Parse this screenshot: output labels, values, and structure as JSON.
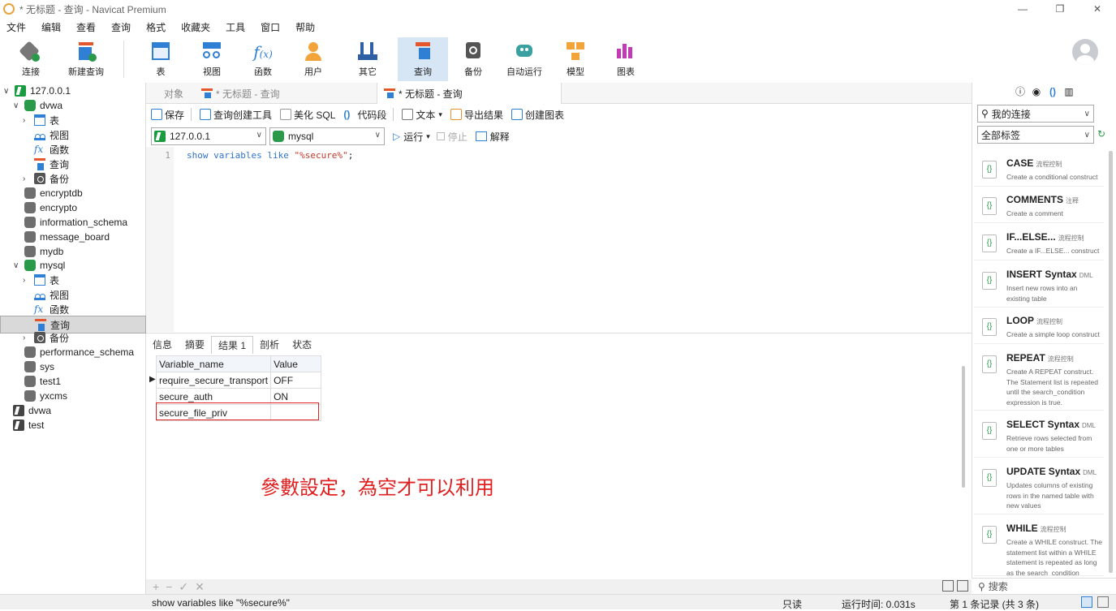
{
  "window": {
    "title": "* 无标题 - 查询 - Navicat Premium",
    "controls": [
      "—",
      "❐",
      "✕"
    ]
  },
  "menu": [
    "文件",
    "编辑",
    "查看",
    "查询",
    "格式",
    "收藏夹",
    "工具",
    "窗口",
    "帮助"
  ],
  "toolbar": [
    {
      "label": "连接",
      "icon": "connection-icon"
    },
    {
      "label": "新建查询",
      "icon": "new-query-icon"
    },
    {
      "label": "表",
      "icon": "table-icon"
    },
    {
      "label": "视图",
      "icon": "view-icon"
    },
    {
      "label": "函数",
      "icon": "function-icon"
    },
    {
      "label": "用户",
      "icon": "user-icon"
    },
    {
      "label": "其它",
      "icon": "tools-icon"
    },
    {
      "label": "查询",
      "icon": "query-icon"
    },
    {
      "label": "备份",
      "icon": "backup-icon"
    },
    {
      "label": "自动运行",
      "icon": "robot-icon"
    },
    {
      "label": "模型",
      "icon": "model-icon"
    },
    {
      "label": "图表",
      "icon": "chart-icon"
    }
  ],
  "tree": {
    "root": "127.0.0.1",
    "dvwa": "dvwa",
    "items_dvwa": [
      "表",
      "视图",
      "函数",
      "查询",
      "备份"
    ],
    "dbs": [
      "encryptdb",
      "encrypto",
      "information_schema",
      "message_board",
      "mydb"
    ],
    "mysql": "mysql",
    "items_mysql": [
      "表",
      "视图",
      "函数",
      "查询",
      "备份"
    ],
    "dbs2": [
      "performance_schema",
      "sys",
      "test1",
      "yxcms"
    ],
    "conns": [
      "dvwa",
      "test"
    ]
  },
  "tabs": {
    "objects": "对象",
    "tab1": "* 无标题 - 查询",
    "tab2": "* 无标题 - 查询"
  },
  "querytoolbar": {
    "save": "保存",
    "builder": "查询创建工具",
    "beautify": "美化 SQL",
    "snippet": "代码段",
    "text": "文本",
    "export": "导出结果",
    "chart": "创建图表"
  },
  "selectors": {
    "connection": "127.0.0.1",
    "database": "mysql",
    "run": "运行",
    "stop": "停止",
    "explain": "解释"
  },
  "editor": {
    "line": "1",
    "code_a": "show variables like ",
    "code_str": "\"%secure%\"",
    "code_b": ";"
  },
  "result_tabs": [
    "信息",
    "摘要",
    "结果 1",
    "剖析",
    "状态"
  ],
  "result": {
    "headers": [
      "Variable_name",
      "Value"
    ],
    "rows": [
      [
        "require_secure_transport",
        "OFF"
      ],
      [
        "secure_auth",
        "ON"
      ],
      [
        "secure_file_priv",
        ""
      ]
    ]
  },
  "annotation": "參數設定，為空才可以利用",
  "bottom_controls": [
    "+",
    "−",
    "✓",
    "✕"
  ],
  "rightpane": {
    "my_connections": "我的连接",
    "all_tags": "全部标签",
    "snippets": [
      {
        "title": "CASE",
        "tag": "流程控制",
        "desc": "Create a conditional construct"
      },
      {
        "title": "COMMENTS",
        "tag": "注释",
        "desc": "Create a comment"
      },
      {
        "title": "IF...ELSE...",
        "tag": "流程控制",
        "desc": "Create a IF...ELSE... construct"
      },
      {
        "title": "INSERT Syntax",
        "tag": "DML",
        "desc": "Insert new rows into an existing table"
      },
      {
        "title": "LOOP",
        "tag": "流程控制",
        "desc": "Create a simple loop construct"
      },
      {
        "title": "REPEAT",
        "tag": "流程控制",
        "desc": "Create A REPEAT construct. The Statement list is repeated until the search_condition expression is true."
      },
      {
        "title": "SELECT Syntax",
        "tag": "DML",
        "desc": "Retrieve rows selected from one or more tables"
      },
      {
        "title": "UPDATE Syntax",
        "tag": "DML",
        "desc": "Updates columns of existing rows in the named table with new values"
      },
      {
        "title": "WHILE",
        "tag": "流程控制",
        "desc": "Create a WHILE construct. The statement list within a WHILE statement is repeated as long as the search_condition"
      }
    ],
    "search": "搜索"
  },
  "status": {
    "sql": "show variables like \"%secure%\"",
    "mode": "只读",
    "time": "运行时间: 0.031s",
    "records": "第 1 条记录 (共 3 条)"
  }
}
